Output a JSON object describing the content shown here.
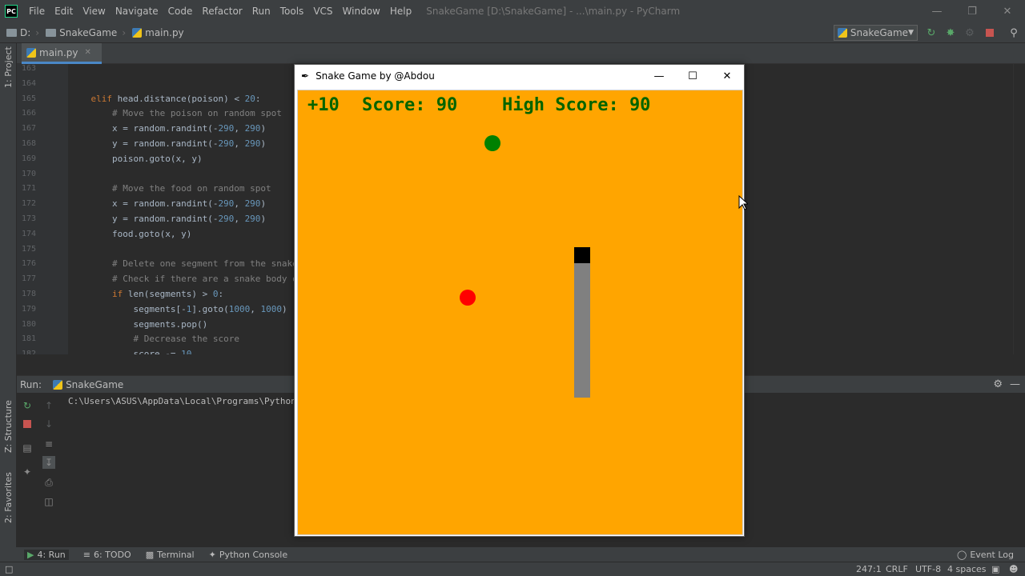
{
  "ide": {
    "menu": [
      "File",
      "Edit",
      "View",
      "Navigate",
      "Code",
      "Refactor",
      "Run",
      "Tools",
      "VCS",
      "Window",
      "Help"
    ],
    "window_title": "SnakeGame [D:\\SnakeGame] - ...\\main.py - PyCharm",
    "breadcrumbs": [
      "D:",
      "SnakeGame",
      "main.py"
    ],
    "run_config": "SnakeGame",
    "tab": "main.py",
    "left_strip": {
      "project": "1: Project",
      "structure": "Z: Structure",
      "favorites": "2: Favorites"
    }
  },
  "code": {
    "lines": [
      {
        "n": "163",
        "html": ""
      },
      {
        "n": "164",
        "html": ""
      },
      {
        "n": "165",
        "html": "    <span class='kw'>elif</span> <span class='tx'>head.distance(poison) &lt; </span><span class='nm'>20</span><span class='tx'>:</span>"
      },
      {
        "n": "166",
        "html": "        <span class='cm'># Move the poison on random spot</span>"
      },
      {
        "n": "167",
        "html": "        <span class='tx'>x = random.randint(-</span><span class='nm'>290</span><span class='tx'>, </span><span class='nm'>290</span><span class='tx'>)</span>"
      },
      {
        "n": "168",
        "html": "        <span class='tx'>y = random.randint(-</span><span class='nm'>290</span><span class='tx'>, </span><span class='nm'>290</span><span class='tx'>)</span>"
      },
      {
        "n": "169",
        "html": "        <span class='tx'>poison.goto(x, y)</span>"
      },
      {
        "n": "170",
        "html": ""
      },
      {
        "n": "171",
        "html": "        <span class='cm'># Move the food on random spot</span>"
      },
      {
        "n": "172",
        "html": "        <span class='tx'>x = random.randint(-</span><span class='nm'>290</span><span class='tx'>, </span><span class='nm'>290</span><span class='tx'>)</span>"
      },
      {
        "n": "173",
        "html": "        <span class='tx'>y = random.randint(-</span><span class='nm'>290</span><span class='tx'>, </span><span class='nm'>290</span><span class='tx'>)</span>"
      },
      {
        "n": "174",
        "html": "        <span class='tx'>food.goto(x, y)</span>"
      },
      {
        "n": "175",
        "html": ""
      },
      {
        "n": "176",
        "html": "        <span class='cm'># Delete one segment from the snake</span>"
      },
      {
        "n": "177",
        "html": "        <span class='cm'># Check if there are a snake body o</span>"
      },
      {
        "n": "178",
        "html": "        <span class='kw'>if</span> <span class='tx'>len(segments) &gt; </span><span class='nm'>0</span><span class='tx'>:</span>"
      },
      {
        "n": "179",
        "html": "            <span class='tx'>segments[-</span><span class='nm'>1</span><span class='tx'>].goto(</span><span class='nm'>1000</span><span class='tx'>, </span><span class='nm'>1000</span><span class='tx'>)</span>"
      },
      {
        "n": "180",
        "html": "            <span class='tx'>segments.pop()</span>"
      },
      {
        "n": "181",
        "html": "            <span class='cm'># Decrease the score</span>"
      },
      {
        "n": "182",
        "html": "            <span class='tx'>score -= </span><span class='nm'>10</span>"
      }
    ]
  },
  "run": {
    "label": "Run:",
    "config": "SnakeGame",
    "console": "C:\\Users\\ASUS\\AppData\\Local\\Programs\\Python"
  },
  "bottom_tabs": [
    "4: Run",
    "6: TODO",
    "Terminal",
    "Python Console"
  ],
  "event_log": "Event Log",
  "status": {
    "position": "247:1",
    "line_sep": "CRLF",
    "encoding": "UTF-8",
    "indent": "4 spaces"
  },
  "game": {
    "window_title": "Snake Game by @Abdou",
    "bonus": "+10",
    "score": "Score: 90",
    "high_score": "High Score: 90",
    "colors": {
      "background": "#ffa500",
      "text": "#006400",
      "food": "#ff0000",
      "poison": "#008000",
      "head": "#000000",
      "body": "#808080"
    }
  }
}
